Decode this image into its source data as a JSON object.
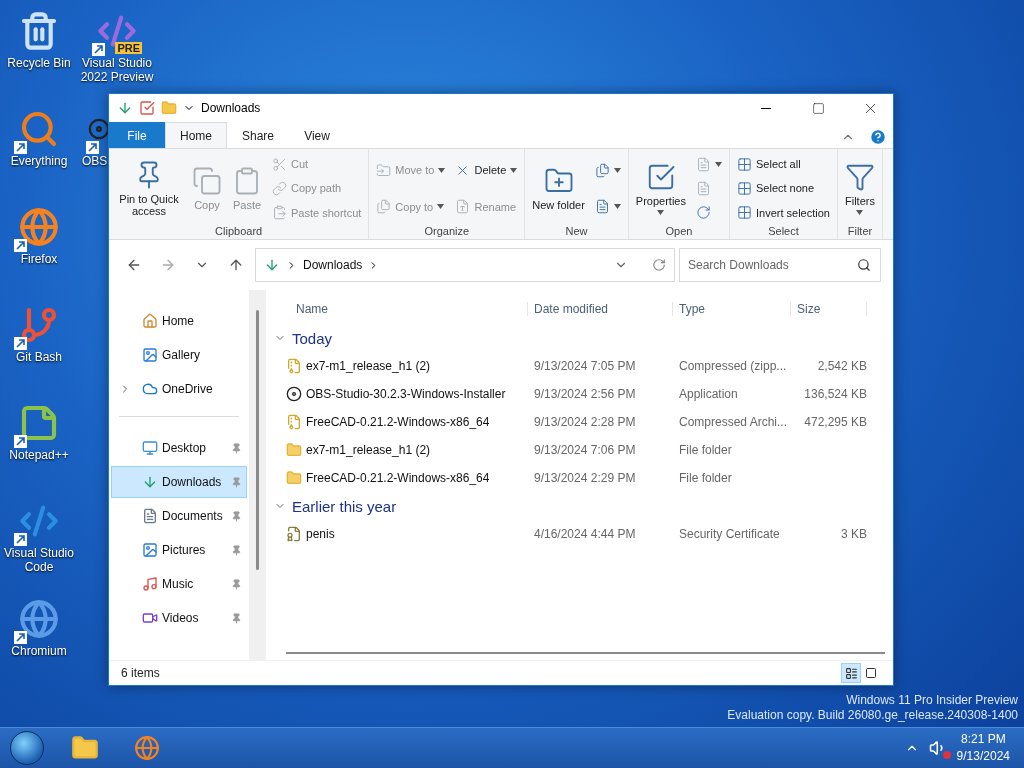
{
  "desktop_icons": [
    {
      "label": "Recycle Bin",
      "kind": "recycle",
      "shortcut": false
    },
    {
      "label": "Everything",
      "kind": "search-app",
      "shortcut": true
    },
    {
      "label": "Firefox",
      "kind": "firefox",
      "shortcut": true
    },
    {
      "label": "Git Bash",
      "kind": "git",
      "shortcut": true
    },
    {
      "label": "Notepad++",
      "kind": "notepad",
      "shortcut": true
    },
    {
      "label": "Visual Studio Code",
      "kind": "code",
      "shortcut": true
    },
    {
      "label": "Chromium",
      "kind": "chromium",
      "shortcut": true
    },
    {
      "label": "Visual Studio 2022 Preview",
      "kind": "vs",
      "shortcut": true,
      "badge": "PRE"
    },
    {
      "label": "OBS",
      "kind": "obs",
      "shortcut": true
    }
  ],
  "window": {
    "title": "Downloads",
    "tabs": [
      {
        "label": "File",
        "kind": "file",
        "selected": false
      },
      {
        "label": "Home",
        "kind": "tab",
        "selected": true
      },
      {
        "label": "Share",
        "kind": "tab",
        "selected": false
      },
      {
        "label": "View",
        "kind": "tab",
        "selected": false
      }
    ],
    "ribbon": [
      {
        "label": "Clipboard",
        "columns": [
          [
            {
              "label": "Pin to Quick access",
              "kind": "large",
              "disabled": false
            }
          ],
          [
            {
              "label": "Copy",
              "kind": "large",
              "disabled": true
            }
          ],
          [
            {
              "label": "Paste",
              "kind": "large",
              "disabled": true
            }
          ],
          [
            {
              "label": "Cut",
              "kind": "small",
              "disabled": true
            },
            {
              "label": "Copy path",
              "kind": "small",
              "disabled": true
            },
            {
              "label": "Paste shortcut",
              "kind": "small",
              "disabled": true
            }
          ]
        ]
      },
      {
        "label": "Organize",
        "columns": [
          [
            {
              "label": "Move to",
              "kind": "small",
              "disabled": true,
              "caret": true
            },
            {
              "label": "Copy to",
              "kind": "small",
              "disabled": true,
              "caret": true
            }
          ],
          [
            {
              "label": "Delete",
              "kind": "small",
              "disabled": false,
              "caret": true
            },
            {
              "label": "Rename",
              "kind": "small",
              "disabled": true
            }
          ]
        ]
      },
      {
        "label": "New",
        "columns": [
          [
            {
              "label": "New folder",
              "kind": "large",
              "disabled": false
            }
          ],
          [
            {
              "kind": "icon",
              "disabled": false,
              "caret": true
            },
            {
              "kind": "icon",
              "disabled": false,
              "caret": true
            }
          ]
        ]
      },
      {
        "label": "Open",
        "columns": [
          [
            {
              "label": "Properties",
              "kind": "large",
              "disabled": false,
              "caret": true
            }
          ],
          [
            {
              "kind": "icon",
              "disabled": true,
              "caret": true
            },
            {
              "kind": "icon",
              "disabled": true
            },
            {
              "kind": "icon",
              "disabled": false
            }
          ]
        ]
      },
      {
        "label": "Select",
        "columns": [
          [
            {
              "label": "Select all",
              "kind": "small",
              "disabled": false
            },
            {
              "label": "Select none",
              "kind": "small",
              "disabled": false
            },
            {
              "label": "Invert selection",
              "kind": "small",
              "disabled": false
            }
          ]
        ]
      },
      {
        "label": "Filter",
        "columns": [
          [
            {
              "label": "Filters",
              "kind": "large",
              "disabled": false,
              "caret": true
            }
          ]
        ]
      }
    ],
    "address": {
      "crumbs": [
        "Downloads"
      ]
    },
    "search": {
      "placeholder": "Search Downloads"
    },
    "nav": [
      [
        {
          "label": "Home",
          "kind": "home",
          "selected": false,
          "pinned": false,
          "expandable": false
        },
        {
          "label": "Gallery",
          "kind": "gallery",
          "selected": false,
          "pinned": false,
          "expandable": false
        },
        {
          "label": "OneDrive",
          "kind": "cloud",
          "selected": false,
          "pinned": false,
          "expandable": true
        }
      ],
      [
        {
          "label": "Desktop",
          "kind": "desktop",
          "selected": false,
          "pinned": true,
          "expandable": false
        },
        {
          "label": "Downloads",
          "kind": "downloads",
          "selected": true,
          "pinned": true,
          "expandable": false
        },
        {
          "label": "Documents",
          "kind": "documents",
          "selected": false,
          "pinned": true,
          "expandable": false
        },
        {
          "label": "Pictures",
          "kind": "pictures",
          "selected": false,
          "pinned": true,
          "expandable": false
        },
        {
          "label": "Music",
          "kind": "music",
          "selected": false,
          "pinned": true,
          "expandable": false
        },
        {
          "label": "Videos",
          "kind": "videos",
          "selected": false,
          "pinned": true,
          "expandable": false
        }
      ]
    ],
    "columns": [
      "Name",
      "Date modified",
      "Type",
      "Size"
    ],
    "groups": [
      {
        "label": "Today",
        "expanded": true,
        "files": [
          {
            "name": "ex7-m1_release_h1 (2)",
            "date": "9/13/2024 7:05 PM",
            "type": "Compressed (zipp...",
            "size": "2,542 KB",
            "kind": "zip"
          },
          {
            "name": "OBS-Studio-30.2.3-Windows-Installer",
            "date": "9/13/2024 2:56 PM",
            "type": "Application",
            "size": "136,524 KB",
            "kind": "app"
          },
          {
            "name": "FreeCAD-0.21.2-Windows-x86_64",
            "date": "9/13/2024 2:28 PM",
            "type": "Compressed Archi...",
            "size": "472,295 KB",
            "kind": "zip"
          },
          {
            "name": "ex7-m1_release_h1 (2)",
            "date": "9/13/2024 7:06 PM",
            "type": "File folder",
            "kind": "folder"
          },
          {
            "name": "FreeCAD-0.21.2-Windows-x86_64",
            "date": "9/13/2024 2:29 PM",
            "type": "File folder",
            "kind": "folder"
          }
        ]
      },
      {
        "label": "Earlier this year",
        "expanded": true,
        "files": [
          {
            "name": "penis",
            "date": "4/16/2024 4:44 PM",
            "type": "Security Certificate",
            "size": "3 KB",
            "kind": "cert"
          }
        ]
      }
    ],
    "status": "6 items",
    "views": [
      {
        "kind": "details",
        "selected": true
      },
      {
        "kind": "tiles",
        "selected": false
      }
    ]
  },
  "os_notice": [
    "Windows 11 Pro Insider Preview",
    "Evaluation copy. Build 26080.ge_release.240308-1400"
  ],
  "taskbar": {
    "apps": [
      {
        "kind": "explorer"
      },
      {
        "kind": "firefox"
      }
    ],
    "time": "8:21 PM",
    "date": "9/13/2024",
    "muted": true
  }
}
